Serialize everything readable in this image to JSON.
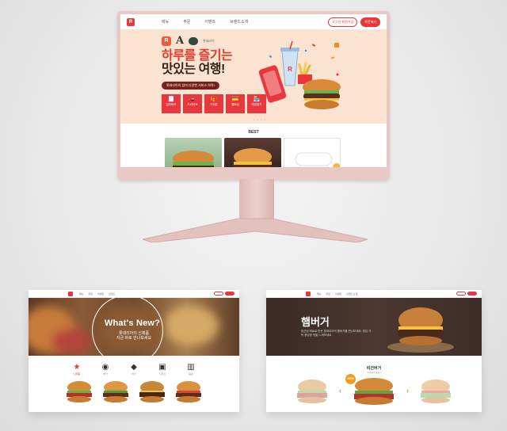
{
  "monitor": {
    "nav": {
      "links": [
        "메뉴",
        "주문",
        "이벤트",
        "브랜드소개"
      ],
      "login_label": "로그인/회원가입",
      "order_label": "주문하기"
    },
    "hero": {
      "brand_badge": "R",
      "brand_letter": "A",
      "brand_text": "롯데리아",
      "title_line1": "하루를 즐기는",
      "title_line2": "맛있는 여행!",
      "subtitle": "롯데리아의 엄마 다양한 서비스 하략!",
      "services": [
        {
          "icon": "receipt-icon",
          "glyph": "🧾",
          "label": "딜리버리"
        },
        {
          "icon": "car-icon",
          "glyph": "🚗",
          "label": "드라이브"
        },
        {
          "icon": "gift-icon",
          "glyph": "🎁",
          "label": "E쿠폰"
        },
        {
          "icon": "card-icon",
          "glyph": "💳",
          "label": "멤버십"
        },
        {
          "icon": "store-icon",
          "glyph": "🏪",
          "label": "매장찾기"
        }
      ],
      "pagination": "• • • •"
    },
    "best": {
      "title": "BEST"
    }
  },
  "left_card": {
    "nav_links": [
      "메뉴",
      "주문",
      "이벤트",
      "브랜드"
    ],
    "hero_title": "What's New?",
    "hero_sub_line1": "롯데리아의 신제품",
    "hero_sub_line2": "지금 바로 만나보세요",
    "categories": [
      {
        "icon": "new-badge-icon",
        "glyph": "★",
        "label": "신제품",
        "active": true
      },
      {
        "icon": "burger-icon",
        "glyph": "◉",
        "label": "버거"
      },
      {
        "icon": "chicken-icon",
        "glyph": "◆",
        "label": "치킨"
      },
      {
        "icon": "dessert-icon",
        "glyph": "▣",
        "label": "디저트"
      },
      {
        "icon": "drink-icon",
        "glyph": "▥",
        "label": "음료"
      }
    ]
  },
  "right_card": {
    "nav_links": [
      "메뉴",
      "주문",
      "이벤트",
      "브랜드소개"
    ],
    "hero_title": "햄버거",
    "hero_desc": "엄선된 재료로 만든 롯데리아의 햄버거를 만나보세요. 한입 가득 풍성한 맛을 느껴보세요",
    "section_title": "비건버거",
    "section_sub": "vegan burger",
    "new_badge": "NEW",
    "arrow_left": "‹",
    "arrow_right": "›"
  },
  "colors": {
    "brand_red": "#e8383d",
    "hero_peach": "#fbe3d2",
    "monitor_pink": "#e9c9c6",
    "arrow_orange": "#f08a24"
  }
}
